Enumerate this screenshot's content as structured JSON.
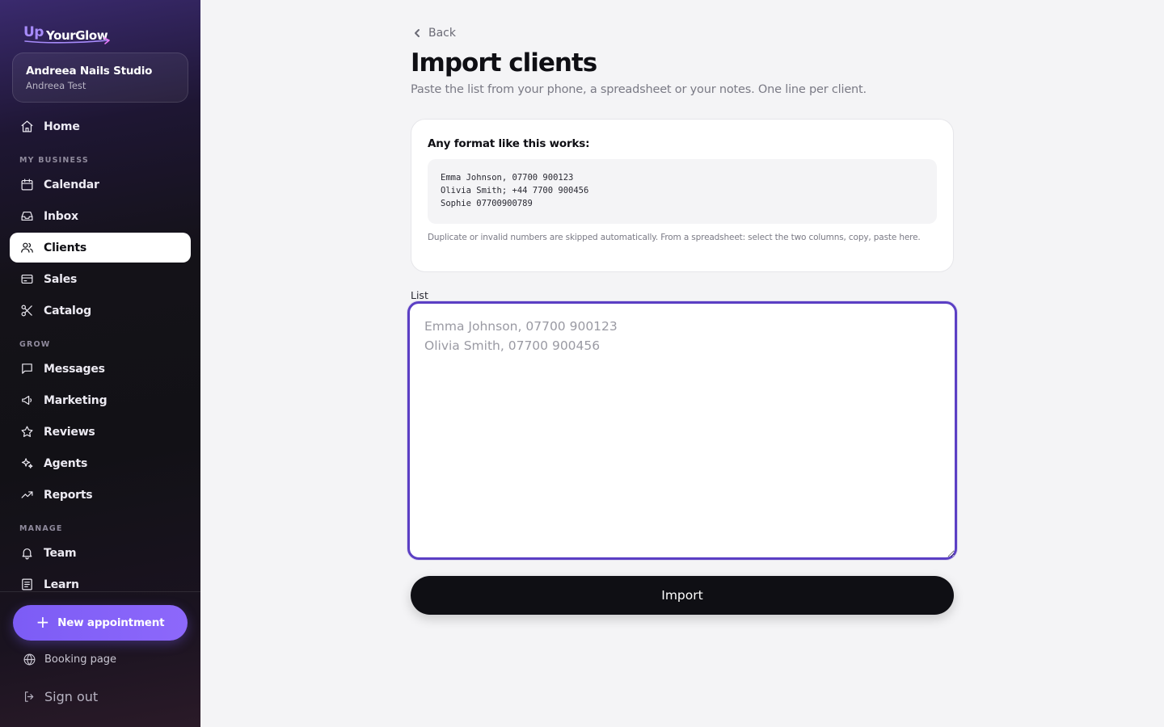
{
  "brand": {
    "logo_up": "Up",
    "logo_main": "YourGlow"
  },
  "studio": {
    "name": "Andreea Nails Studio",
    "user": "Andreea Test"
  },
  "nav": {
    "home": "Home",
    "section_business": "MY BUSINESS",
    "calendar": "Calendar",
    "inbox": "Inbox",
    "clients": "Clients",
    "sales": "Sales",
    "catalog": "Catalog",
    "section_grow": "GROW",
    "messages": "Messages",
    "marketing": "Marketing",
    "reviews": "Reviews",
    "agents": "Agents",
    "reports": "Reports",
    "section_manage": "MANAGE",
    "team": "Team",
    "learn": "Learn"
  },
  "actions": {
    "new_appointment": "New appointment",
    "booking_page": "Booking page",
    "sign_out": "Sign out"
  },
  "page": {
    "back": "Back",
    "title": "Import clients",
    "subtitle": "Paste the list from your phone, a spreadsheet or your notes. One line per client."
  },
  "format_card": {
    "title": "Any format like this works:",
    "example_lines": [
      "Emma Johnson, 07700 900123",
      "Olivia Smith; +44 7700 900456",
      "Sophie 07700900789"
    ],
    "note": "Duplicate or invalid numbers are skipped automatically. From a spreadsheet: select the two columns, copy, paste here."
  },
  "list_field": {
    "label": "List",
    "value": "",
    "placeholder": "Emma Johnson, 07700 900123\nOlivia Smith, 07700 900456"
  },
  "import_button": "Import",
  "colors": {
    "accent": "#7c5cf5",
    "focus_border": "#5b3fc4",
    "primary_button": "#0f0f14",
    "page_bg": "#f4f4f6"
  }
}
